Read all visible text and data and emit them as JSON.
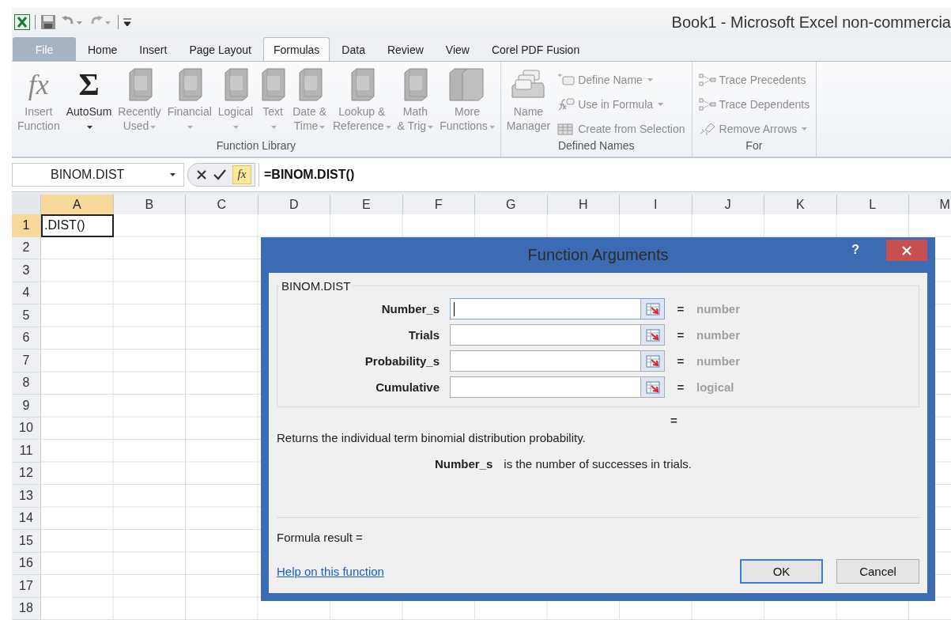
{
  "title_bar": {
    "title": "Book1  -  Microsoft Excel non-commercia"
  },
  "tabs": [
    {
      "label": "File",
      "kind": "file",
      "selected": false
    },
    {
      "label": "Home",
      "kind": "tab",
      "selected": false
    },
    {
      "label": "Insert",
      "kind": "tab",
      "selected": false
    },
    {
      "label": "Page Layout",
      "kind": "tab",
      "selected": false
    },
    {
      "label": "Formulas",
      "kind": "tab",
      "selected": true
    },
    {
      "label": "Data",
      "kind": "tab",
      "selected": false
    },
    {
      "label": "Review",
      "kind": "tab",
      "selected": false
    },
    {
      "label": "View",
      "kind": "tab",
      "selected": false
    },
    {
      "label": "Corel PDF Fusion",
      "kind": "tab",
      "selected": false
    }
  ],
  "ribbon": {
    "groups": [
      {
        "label": "Function Library",
        "large_buttons": [
          {
            "label": "Insert\nFunction",
            "kind": "fx",
            "glyph": "fx",
            "disabled": true,
            "dropdown": false
          },
          {
            "label": "AutoSum",
            "kind": "sigma",
            "glyph": "Σ",
            "disabled": false,
            "dropdown": true
          },
          {
            "label": "Recently\nUsed",
            "kind": "book",
            "disabled": true,
            "dropdown": true
          },
          {
            "label": "Financial",
            "kind": "book",
            "disabled": true,
            "dropdown": true
          },
          {
            "label": "Logical",
            "kind": "book",
            "disabled": true,
            "dropdown": true
          },
          {
            "label": "Text",
            "kind": "book",
            "disabled": true,
            "dropdown": true
          },
          {
            "label": "Date &\nTime",
            "kind": "book",
            "disabled": true,
            "dropdown": true
          },
          {
            "label": "Lookup &\nReference",
            "kind": "book",
            "disabled": true,
            "dropdown": true
          },
          {
            "label": "Math\n& Trig",
            "kind": "book",
            "disabled": true,
            "dropdown": true
          },
          {
            "label": "More\nFunctions",
            "kind": "books",
            "disabled": true,
            "dropdown": true
          }
        ]
      },
      {
        "label": "Defined Names",
        "large_buttons": [
          {
            "label": "Name\nManager",
            "kind": "cardbox",
            "disabled": true,
            "dropdown": false
          }
        ],
        "small_buttons": [
          {
            "label": "Define Name",
            "kind": "tag",
            "disabled": true,
            "dropdown": true
          },
          {
            "label": "Use in Formula",
            "kind": "fxtag",
            "disabled": true,
            "dropdown": true
          },
          {
            "label": "Create from Selection",
            "kind": "table",
            "disabled": true,
            "dropdown": false
          }
        ]
      },
      {
        "label": "For",
        "small_buttons": [
          {
            "label": "Trace Precedents",
            "kind": "trace",
            "disabled": true,
            "dropdown": false
          },
          {
            "label": "Trace Dependents",
            "kind": "trace",
            "disabled": true,
            "dropdown": false
          },
          {
            "label": "Remove Arrows",
            "kind": "eraser",
            "disabled": true,
            "dropdown": true
          }
        ]
      }
    ]
  },
  "formula_bar": {
    "name_box": "BINOM.DIST",
    "fx": "fx",
    "formula": "=BINOM.DIST()"
  },
  "sheet": {
    "columns": [
      {
        "label": "A",
        "selected": true
      },
      {
        "label": "B",
        "selected": false
      },
      {
        "label": "C",
        "selected": false
      },
      {
        "label": "D",
        "selected": false
      },
      {
        "label": "E",
        "selected": false
      },
      {
        "label": "F",
        "selected": false
      },
      {
        "label": "G",
        "selected": false
      },
      {
        "label": "H",
        "selected": false
      },
      {
        "label": "I",
        "selected": false
      },
      {
        "label": "J",
        "selected": false
      },
      {
        "label": "K",
        "selected": false
      },
      {
        "label": "L",
        "selected": false
      },
      {
        "label": "M",
        "selected": false
      }
    ],
    "rows": [
      {
        "label": "1",
        "selected": true,
        "cells": [
          {
            "text": ".DIST()",
            "active": true
          }
        ]
      },
      {
        "label": "2",
        "selected": false
      },
      {
        "label": "3",
        "selected": false
      },
      {
        "label": "4",
        "selected": false
      },
      {
        "label": "5",
        "selected": false
      },
      {
        "label": "6",
        "selected": false
      },
      {
        "label": "7",
        "selected": false
      },
      {
        "label": "8",
        "selected": false
      },
      {
        "label": "9",
        "selected": false
      },
      {
        "label": "10",
        "selected": false
      },
      {
        "label": "11",
        "selected": false
      },
      {
        "label": "12",
        "selected": false
      },
      {
        "label": "13",
        "selected": false
      },
      {
        "label": "14",
        "selected": false
      },
      {
        "label": "15",
        "selected": false
      },
      {
        "label": "16",
        "selected": false
      },
      {
        "label": "17",
        "selected": false
      },
      {
        "label": "18",
        "selected": false
      }
    ]
  },
  "dialog": {
    "title": "Function Arguments",
    "help": "?",
    "function_name": "BINOM.DIST",
    "arguments": [
      {
        "label": "Number_s",
        "focused": true,
        "equals": "=",
        "hint": "number"
      },
      {
        "label": "Trials",
        "focused": false,
        "equals": "=",
        "hint": "number"
      },
      {
        "label": "Probability_s",
        "focused": false,
        "equals": "=",
        "hint": "number"
      },
      {
        "label": "Cumulative",
        "focused": false,
        "equals": "=",
        "hint": "logical"
      }
    ],
    "result_equals": "=",
    "description": "Returns the individual term binomial distribution probability.",
    "argument_help": {
      "name": "Number_s",
      "text": "is the number of successes in trials."
    },
    "formula_result": "Formula result =",
    "help_link": "Help on this function",
    "buttons": [
      {
        "label": "OK",
        "default": true
      },
      {
        "label": "Cancel",
        "default": false
      }
    ]
  }
}
